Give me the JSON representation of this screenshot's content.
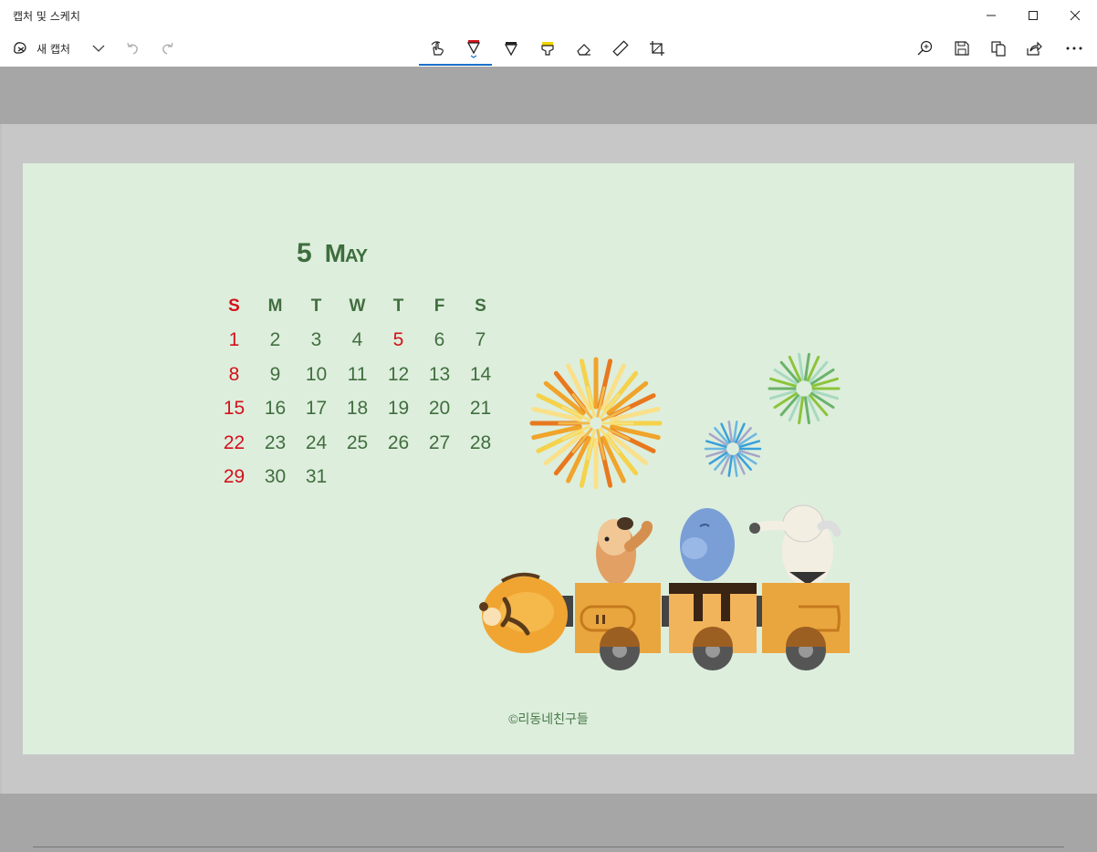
{
  "window": {
    "title": "캡처 및 스케치"
  },
  "toolbar": {
    "new_capture_label": "새 캡처"
  },
  "calendar": {
    "month_number": "5",
    "month_name": "May",
    "weekdays": [
      "S",
      "M",
      "T",
      "W",
      "T",
      "F",
      "S"
    ],
    "weeks": [
      [
        "1",
        "2",
        "3",
        "4",
        "5",
        "6",
        "7"
      ],
      [
        "8",
        "9",
        "10",
        "11",
        "12",
        "13",
        "14"
      ],
      [
        "15",
        "16",
        "17",
        "18",
        "19",
        "20",
        "21"
      ],
      [
        "22",
        "23",
        "24",
        "25",
        "26",
        "27",
        "28"
      ],
      [
        "29",
        "30",
        "31",
        "",
        "",
        "",
        ""
      ]
    ],
    "holidays": [
      "5"
    ]
  },
  "footer": {
    "copyright": "©리동네친구들"
  },
  "colors": {
    "accent": "#1a6fc9",
    "wallpaper_bg": "#ddeedd",
    "calendar_text": "#416e3e",
    "sunday_red": "#d4101a"
  }
}
